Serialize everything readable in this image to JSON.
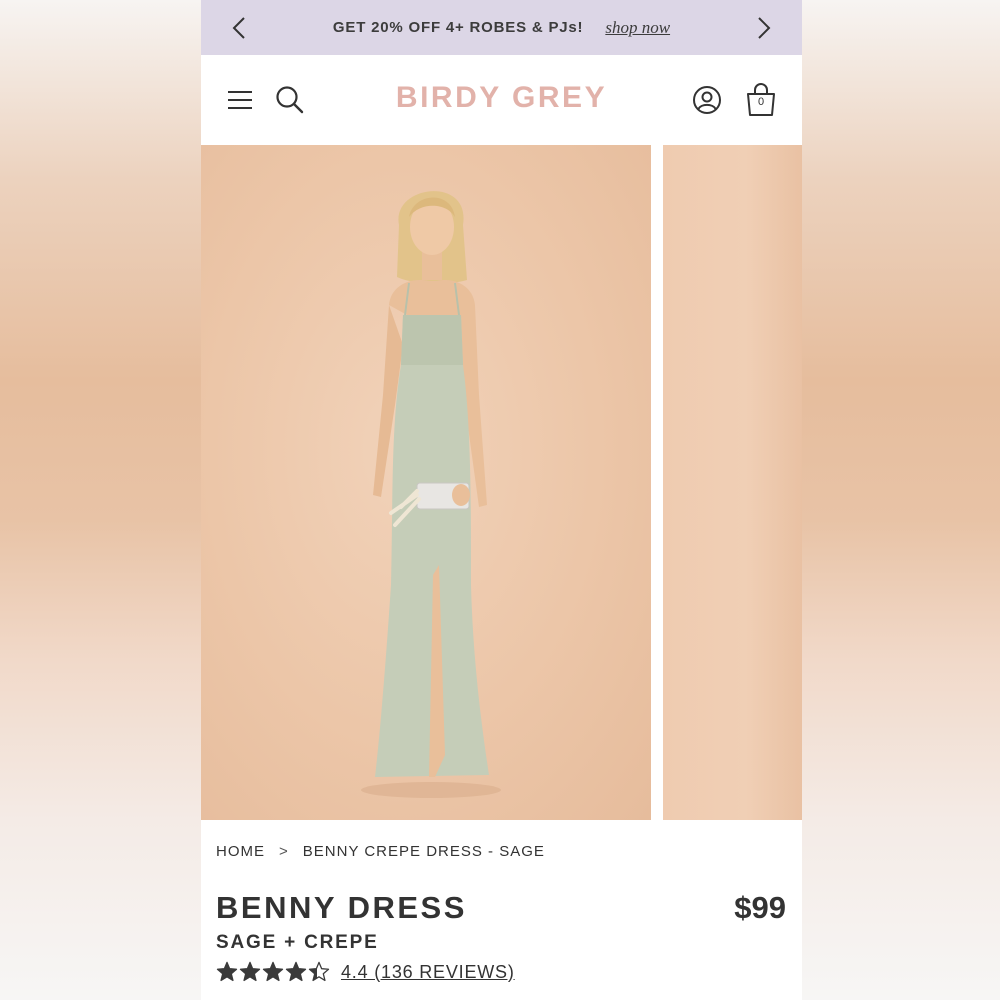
{
  "promo": {
    "text": "GET 20% OFF 4+ ROBES & PJs!",
    "link": "shop now",
    "background": "#dcd6e6"
  },
  "header": {
    "logo": "BIRDY GREY",
    "logo_color": "#e2b2aa",
    "cart_count": "0",
    "icons": [
      "hamburger-menu-icon",
      "search-icon",
      "account-icon",
      "shopping-bag-icon"
    ]
  },
  "gallery": {
    "dress_color": "#c5cdb8",
    "backdrop_color": "#ecc6a8"
  },
  "breadcrumb": {
    "home": "HOME",
    "separator": ">",
    "current": "BENNY CREPE DRESS - SAGE"
  },
  "product": {
    "title": "BENNY DRESS",
    "price": "$99",
    "variant": "SAGE + CREPE",
    "rating_value": 4.4,
    "rating_max": 5,
    "rating_text": "4.4 (136 REVIEWS)"
  }
}
